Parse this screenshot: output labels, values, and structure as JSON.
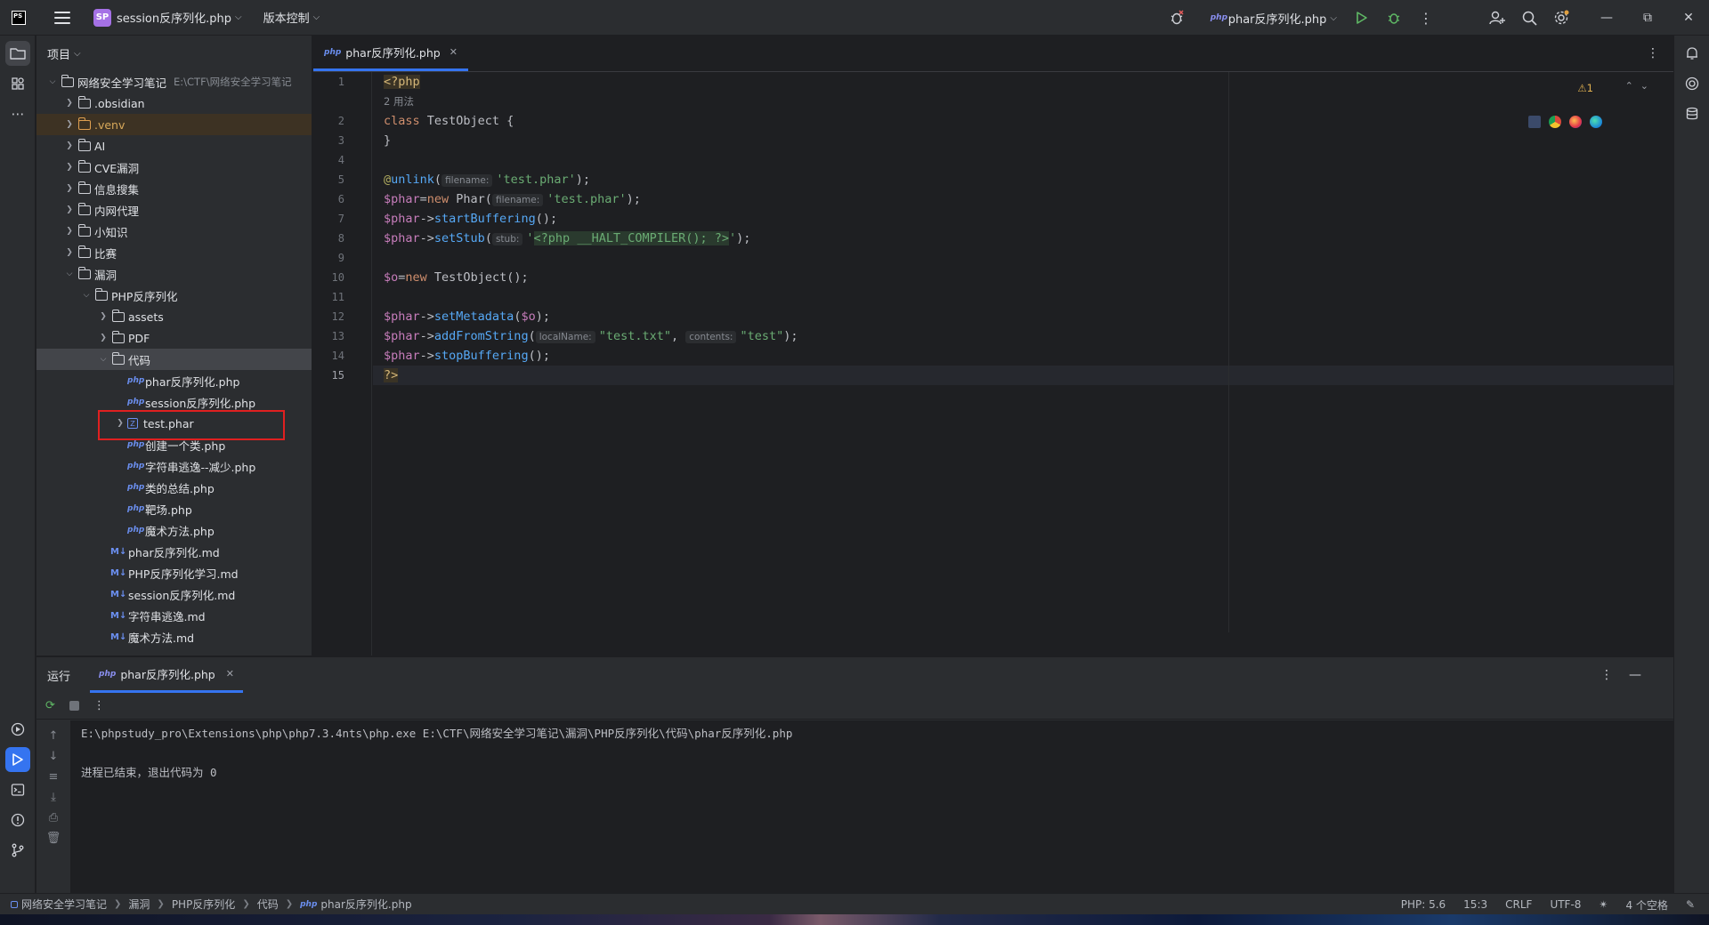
{
  "titlebar": {
    "app_logo": "PS",
    "project_badge": "SP",
    "project_name": "session反序列化.php",
    "vcs_menu": "版本控制",
    "run_config": "phar反序列化.php",
    "run_config_icon_text": "php"
  },
  "project_panel": {
    "header": "项目",
    "root": {
      "name": "网络安全学习笔记",
      "path": "E:\\CTF\\网络安全学习笔记"
    },
    "items": [
      {
        "name": ".obsidian",
        "type": "folder",
        "depth": 1,
        "expanded": false
      },
      {
        "name": ".venv",
        "type": "folder-orange",
        "depth": 1,
        "expanded": false
      },
      {
        "name": "AI",
        "type": "folder",
        "depth": 1,
        "expanded": false
      },
      {
        "name": "CVE漏洞",
        "type": "folder",
        "depth": 1,
        "expanded": false
      },
      {
        "name": "信息搜集",
        "type": "folder",
        "depth": 1,
        "expanded": false
      },
      {
        "name": "内网代理",
        "type": "folder",
        "depth": 1,
        "expanded": false
      },
      {
        "name": "小知识",
        "type": "folder",
        "depth": 1,
        "expanded": false
      },
      {
        "name": "比赛",
        "type": "folder",
        "depth": 1,
        "expanded": false
      },
      {
        "name": "漏洞",
        "type": "folder",
        "depth": 1,
        "expanded": true
      },
      {
        "name": "PHP反序列化",
        "type": "folder",
        "depth": 2,
        "expanded": true
      },
      {
        "name": "assets",
        "type": "folder",
        "depth": 3,
        "expanded": false
      },
      {
        "name": "PDF",
        "type": "folder",
        "depth": 3,
        "expanded": false
      },
      {
        "name": "代码",
        "type": "folder",
        "depth": 3,
        "expanded": true,
        "selected": true
      },
      {
        "name": "phar反序列化.php",
        "type": "php",
        "depth": 4
      },
      {
        "name": "session反序列化.php",
        "type": "php",
        "depth": 4
      },
      {
        "name": "test.phar",
        "type": "phar",
        "depth": 4,
        "expandable": true
      },
      {
        "name": "创建一个类.php",
        "type": "php",
        "depth": 4
      },
      {
        "name": "字符串逃逸--减少.php",
        "type": "php",
        "depth": 4
      },
      {
        "name": "类的总结.php",
        "type": "php",
        "depth": 4
      },
      {
        "name": "靶场.php",
        "type": "php",
        "depth": 4
      },
      {
        "name": "魔术方法.php",
        "type": "php",
        "depth": 4
      },
      {
        "name": "phar反序列化.md",
        "type": "md",
        "depth": 3
      },
      {
        "name": "PHP反序列化学习.md",
        "type": "md",
        "depth": 3
      },
      {
        "name": "session反序列化.md",
        "type": "md",
        "depth": 3
      },
      {
        "name": "字符串逃逸.md",
        "type": "md",
        "depth": 3
      },
      {
        "name": "魔术方法.md",
        "type": "md",
        "depth": 3
      }
    ]
  },
  "editor": {
    "tab_label": "phar反序列化.php",
    "tab_icon_text": "php",
    "warning_count": "1",
    "usages_hint": "2 用法",
    "lines": [
      "1",
      "2",
      "3",
      "4",
      "5",
      "6",
      "7",
      "8",
      "9",
      "10",
      "11",
      "12",
      "13",
      "14",
      "15"
    ],
    "code": {
      "l1": "<?php",
      "l2_kw": "class",
      "l2_rest": " TestObject {",
      "l3": "}",
      "l5_ann": "@",
      "l5_fn": "unlink",
      "l5_hint": "filename:",
      "l5_str": "'test.phar'",
      "l5_end": ");",
      "l6_var": "$phar",
      "l6_eq": "=",
      "l6_kw": "new",
      "l6_cls": " Phar(",
      "l6_hint": "filename:",
      "l6_str": "'test.phar'",
      "l6_end": ");",
      "l7_var": "$phar",
      "l7_arrow": "->",
      "l7_fn": "startBuffering",
      "l7_end": "();",
      "l8_var": "$phar",
      "l8_arrow": "->",
      "l8_fn": "setStub",
      "l8_open": "(",
      "l8_hint": "stub:",
      "l8_q1": "'",
      "l8_inj": "<?php __HALT_COMPILER(); ?>",
      "l8_q2": "'",
      "l8_end": ");",
      "l10_var": "$o",
      "l10_eq": "=",
      "l10_kw": "new",
      "l10_rest": " TestObject();",
      "l12_var": "$phar",
      "l12_arrow": "->",
      "l12_fn": "setMetadata",
      "l12_open": "(",
      "l12_arg": "$o",
      "l12_end": ");",
      "l13_var": "$phar",
      "l13_arrow": "->",
      "l13_fn": "addFromString",
      "l13_open": "(",
      "l13_hint1": "localName:",
      "l13_str1": "\"test.txt\"",
      "l13_comma": ", ",
      "l13_hint2": "contents:",
      "l13_str2": "\"test\"",
      "l13_end": ");",
      "l14_var": "$phar",
      "l14_arrow": "->",
      "l14_fn": "stopBuffering",
      "l14_end": "();",
      "l15": "?>"
    }
  },
  "run_panel": {
    "title": "运行",
    "tab_label": "phar反序列化.php",
    "tab_icon_text": "php",
    "output": [
      "E:\\phpstudy_pro\\Extensions\\php\\php7.3.4nts\\php.exe E:\\CTF\\网络安全学习笔记\\漏洞\\PHP反序列化\\代码\\phar反序列化.php",
      "",
      "进程已结束，退出代码为 0"
    ]
  },
  "statusbar": {
    "breadcrumb": [
      "网络安全学习笔记",
      "漏洞",
      "PHP反序列化",
      "代码",
      "phar反序列化.php"
    ],
    "breadcrumb_icon_text": "php",
    "php_version": "PHP: 5.6",
    "position": "15:3",
    "line_ending": "CRLF",
    "encoding": "UTF-8",
    "indent": "4 个空格"
  },
  "colors": {
    "accent": "#3574f0",
    "panel_bg": "#2b2d30",
    "editor_bg": "#1e1f22",
    "highlight_box": "#e02020"
  }
}
